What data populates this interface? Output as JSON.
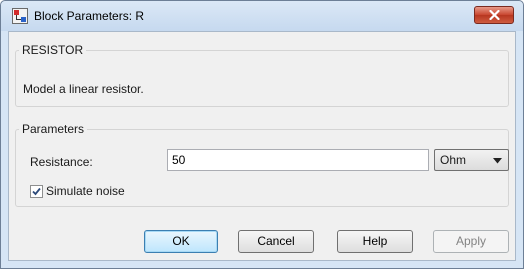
{
  "window": {
    "title": "Block Parameters: R"
  },
  "block": {
    "name": "RESISTOR",
    "description": "Model a linear resistor."
  },
  "parameters": {
    "group_title": "Parameters",
    "resistance_label": "Resistance:",
    "resistance_value": "50",
    "unit_selected": "Ohm",
    "simulate_noise_label": "Simulate noise",
    "simulate_noise_checked": true
  },
  "buttons": {
    "ok": "OK",
    "cancel": "Cancel",
    "help": "Help",
    "apply": "Apply"
  },
  "colors": {
    "title_bar": "#c6d9ef",
    "close_button": "#c8452e",
    "dialog_background": "#f0f0f0",
    "default_button": "#bee6fd"
  },
  "icons": {
    "app": "simulink-block-icon",
    "close": "close-icon",
    "dropdown": "chevron-down-icon",
    "check": "checkmark-icon"
  }
}
